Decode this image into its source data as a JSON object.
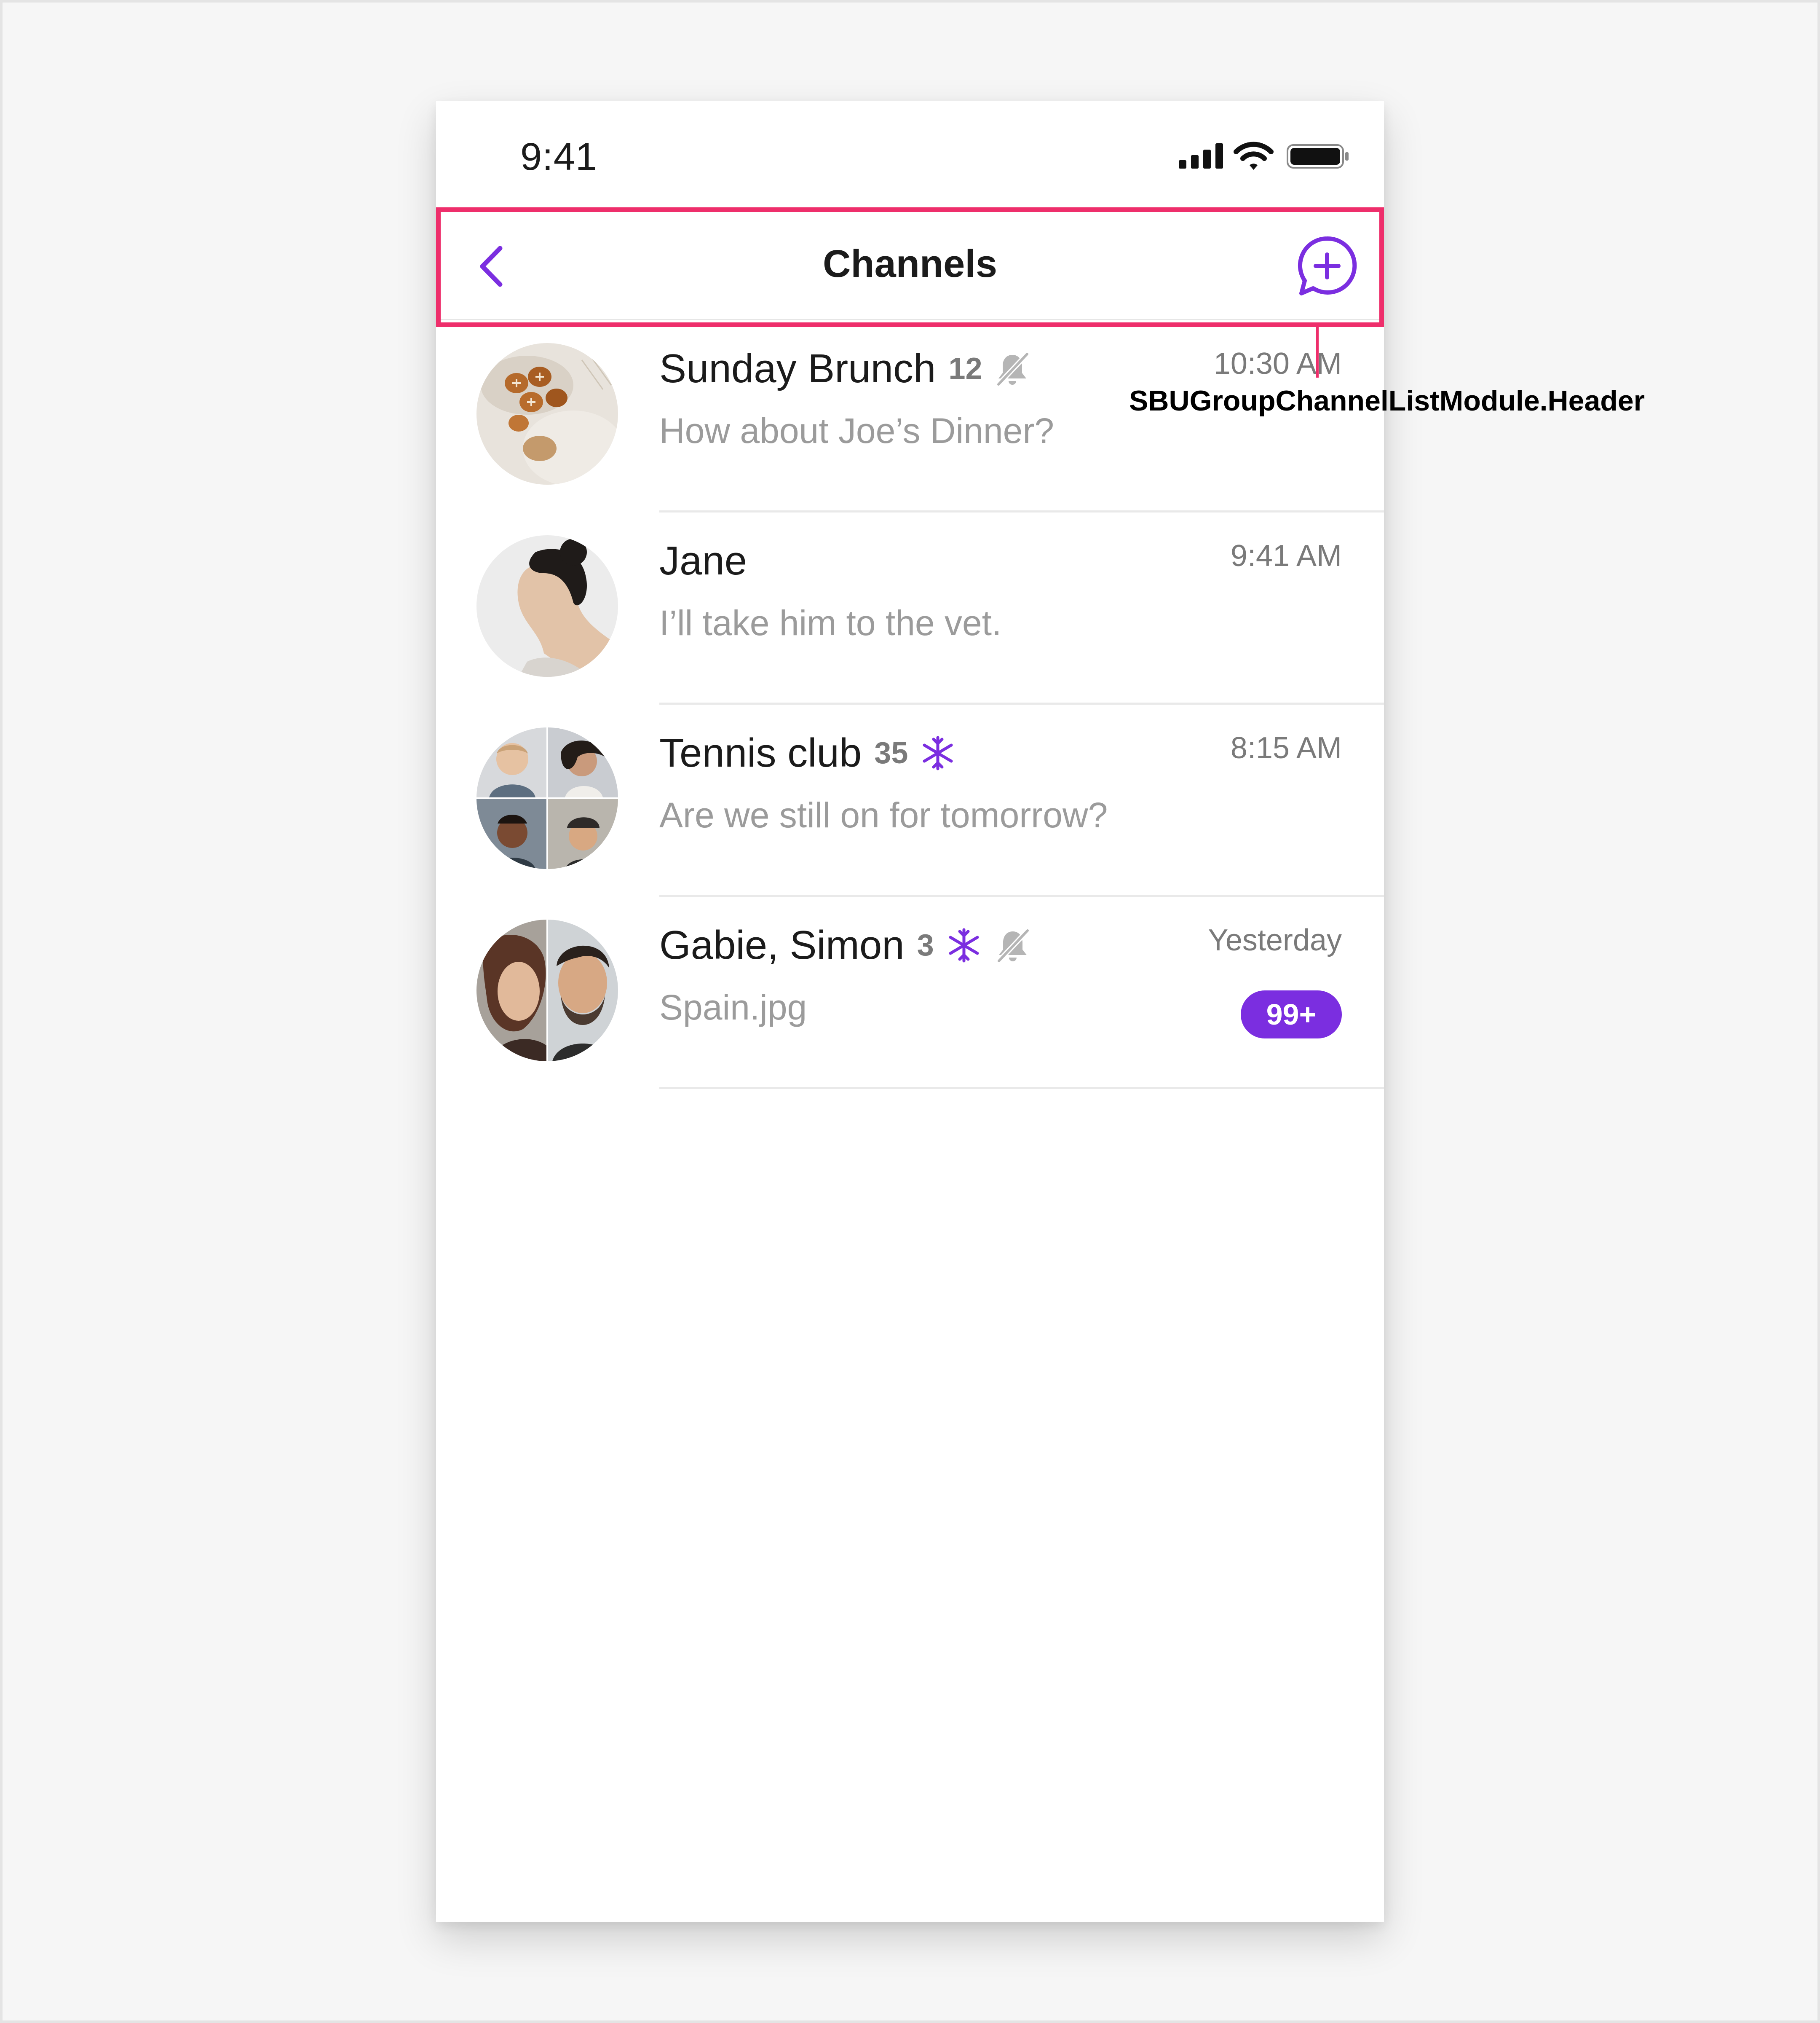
{
  "status_bar": {
    "time": "9:41"
  },
  "header": {
    "title": "Channels"
  },
  "channels": [
    {
      "name": "Sunday Brunch",
      "member_count": "12",
      "muted": true,
      "frozen": false,
      "time": "10:30 AM",
      "last_message": "How about Joe’s Dinner?",
      "unread": ""
    },
    {
      "name": "Jane",
      "member_count": "",
      "muted": false,
      "frozen": false,
      "time": "9:41 AM",
      "last_message": "I’ll take him to the vet.",
      "unread": ""
    },
    {
      "name": "Tennis club",
      "member_count": "35",
      "muted": false,
      "frozen": true,
      "time": "8:15 AM",
      "last_message": "Are we still on for tomorrow?",
      "unread": ""
    },
    {
      "name": "Gabie, Simon",
      "member_count": "3",
      "muted": true,
      "frozen": true,
      "time": "Yesterday",
      "last_message": "Spain.jpg",
      "unread": "99+"
    }
  ],
  "annotation": {
    "label": "SBUGroupChannelListModule.Header"
  },
  "colors": {
    "accent": "#7b2ee0",
    "highlight": "#ee2e6b",
    "muted_icon": "#b5b5b5"
  }
}
